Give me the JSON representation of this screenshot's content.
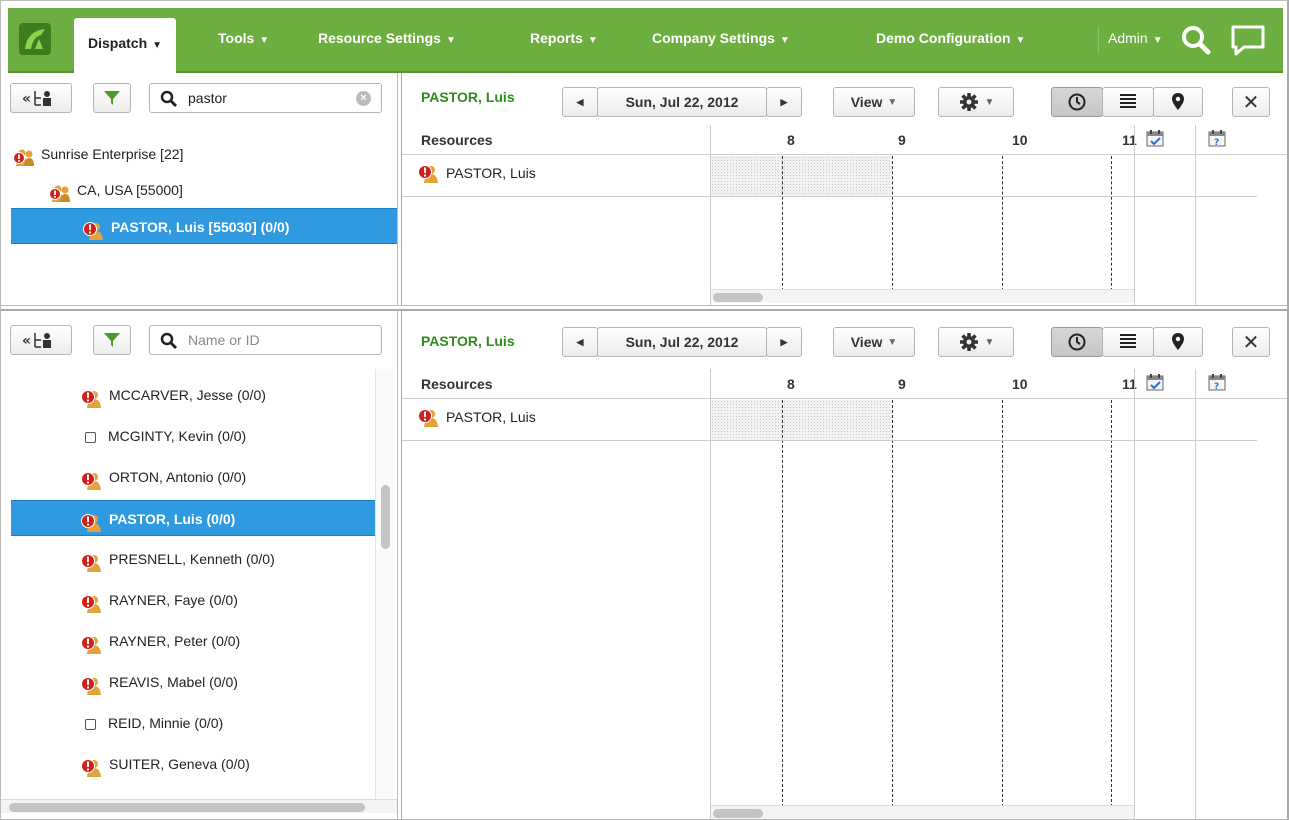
{
  "nav": {
    "tabs": [
      {
        "label": "Dispatch",
        "active": true
      },
      {
        "label": "Tools"
      },
      {
        "label": "Resource Settings"
      },
      {
        "label": "Reports"
      },
      {
        "label": "Company Settings"
      },
      {
        "label": "Demo Configuration"
      }
    ],
    "user": "Admin",
    "icons": [
      "app-logo-icon",
      "search-icon",
      "chat-icon"
    ],
    "color": "#6cae3f"
  },
  "pane1": {
    "search": {
      "value": "pastor",
      "placeholder": "Name or ID"
    },
    "tree": [
      {
        "label": "Sunrise Enterprise [22]",
        "icon": "group-icon",
        "level": 0
      },
      {
        "label": "CA, USA [55000]",
        "icon": "group-icon",
        "level": 1
      },
      {
        "label": "PASTOR, Luis [55030] (0/0)",
        "icon": "person-alert-icon",
        "level": 2,
        "selected": true
      }
    ],
    "resource_name": "PASTOR, Luis",
    "date": "Sun, Jul 22, 2012",
    "view_label": "View",
    "grid": {
      "resources_header": "Resources",
      "hours": [
        "8",
        "9",
        "10",
        "11"
      ],
      "rows": [
        "PASTOR, Luis"
      ]
    }
  },
  "pane2": {
    "search": {
      "value": "",
      "placeholder": "Name or ID"
    },
    "list": [
      {
        "label": "MCCARVER, Jesse (0/0)",
        "icon": "person-alert-icon"
      },
      {
        "label": "MCGINTY, Kevin (0/0)",
        "icon": "checkbox-icon"
      },
      {
        "label": "ORTON, Antonio (0/0)",
        "icon": "person-alert-icon"
      },
      {
        "label": "PASTOR, Luis (0/0)",
        "icon": "person-alert-icon",
        "selected": true
      },
      {
        "label": "PRESNELL, Kenneth (0/0)",
        "icon": "person-alert-icon"
      },
      {
        "label": "RAYNER, Faye (0/0)",
        "icon": "person-alert-icon"
      },
      {
        "label": "RAYNER, Peter (0/0)",
        "icon": "person-alert-icon"
      },
      {
        "label": "REAVIS, Mabel (0/0)",
        "icon": "person-alert-icon"
      },
      {
        "label": "REID, Minnie (0/0)",
        "icon": "checkbox-icon"
      },
      {
        "label": "SUITER, Geneva (0/0)",
        "icon": "person-alert-icon"
      }
    ],
    "resource_name": "PASTOR, Luis",
    "date": "Sun, Jul 22, 2012",
    "view_label": "View",
    "grid": {
      "resources_header": "Resources",
      "hours": [
        "8",
        "9",
        "10",
        "11"
      ],
      "rows": [
        "PASTOR, Luis"
      ]
    }
  },
  "colors": {
    "accent_green": "#2e8b1e",
    "selection_blue": "#2f9ae0",
    "alert_red": "#d0201a"
  }
}
